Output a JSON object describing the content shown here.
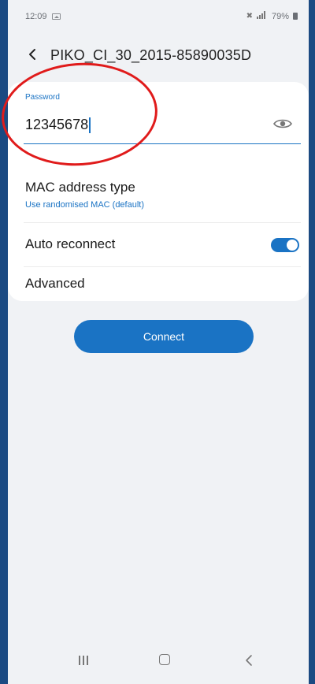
{
  "status_bar": {
    "time": "12:09",
    "battery": "79%",
    "icons": [
      "gallery-icon",
      "mute-icon",
      "signal-icon",
      "battery-icon"
    ]
  },
  "header": {
    "back_icon": "chevron-left-icon",
    "title": "PIKO_CI_30_2015-85890035D"
  },
  "password": {
    "label": "Password",
    "value": "12345678",
    "visibility_icon": "eye-icon"
  },
  "mac": {
    "title": "MAC address type",
    "subtitle": "Use randomised MAC (default)"
  },
  "auto_reconnect": {
    "label": "Auto reconnect",
    "enabled": true
  },
  "advanced": {
    "label": "Advanced"
  },
  "connect_button": {
    "label": "Connect"
  },
  "nav_bar": {
    "icons": [
      "recents-icon",
      "home-icon",
      "back-icon"
    ]
  },
  "colors": {
    "accent": "#1a73c4",
    "annotation": "#e01b1b",
    "background": "#f0f2f5",
    "frame": "#1b4a82"
  }
}
